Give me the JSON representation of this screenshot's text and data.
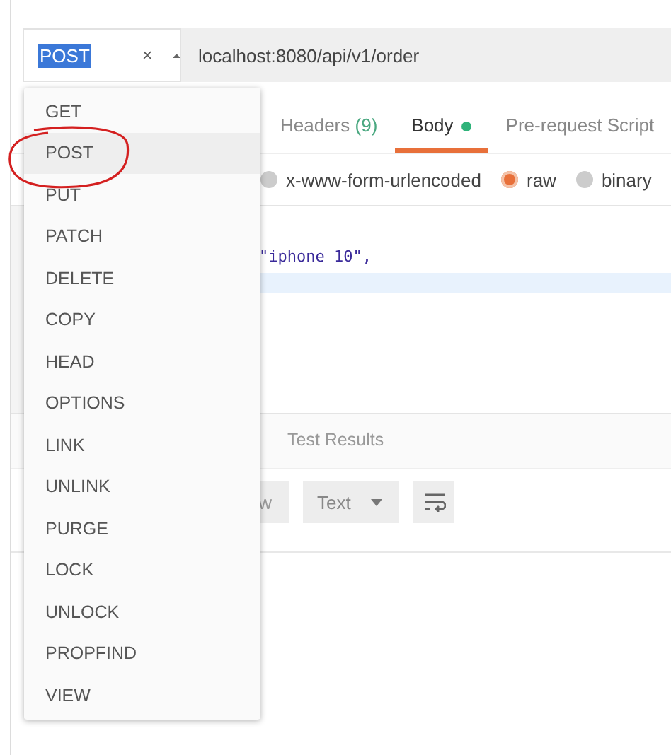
{
  "request": {
    "method": "POST",
    "url": "localhost:8080/api/v1/order"
  },
  "method_menu": {
    "items": [
      {
        "label": "GET",
        "selected": false
      },
      {
        "label": "POST",
        "selected": true
      },
      {
        "label": "PUT",
        "selected": false
      },
      {
        "label": "PATCH",
        "selected": false
      },
      {
        "label": "DELETE",
        "selected": false
      },
      {
        "label": "COPY",
        "selected": false
      },
      {
        "label": "HEAD",
        "selected": false
      },
      {
        "label": "OPTIONS",
        "selected": false
      },
      {
        "label": "LINK",
        "selected": false
      },
      {
        "label": "UNLINK",
        "selected": false
      },
      {
        "label": "PURGE",
        "selected": false
      },
      {
        "label": "LOCK",
        "selected": false
      },
      {
        "label": "UNLOCK",
        "selected": false
      },
      {
        "label": "PROPFIND",
        "selected": false
      },
      {
        "label": "VIEW",
        "selected": false
      }
    ]
  },
  "tabs": [
    {
      "label": "Headers",
      "count": "(9)",
      "selected": false,
      "dot": false
    },
    {
      "label": "Body",
      "selected": true,
      "dot": true
    },
    {
      "label": "Pre-request Script",
      "selected": false,
      "dot": false
    }
  ],
  "body_types": [
    {
      "label": "x-www-form-urlencoded",
      "selected": false
    },
    {
      "label": "raw",
      "selected": true
    },
    {
      "label": "binary",
      "selected": false
    }
  ],
  "editor": {
    "lines": [
      {
        "text": "\"iphone 10\",",
        "highlighted": false
      },
      {
        "highlighted": true
      }
    ]
  },
  "response_tabs": [
    {
      "label": "Test Results",
      "selected": false
    }
  ],
  "toolbar": {
    "view_fragment": "w",
    "format": "Text"
  }
}
